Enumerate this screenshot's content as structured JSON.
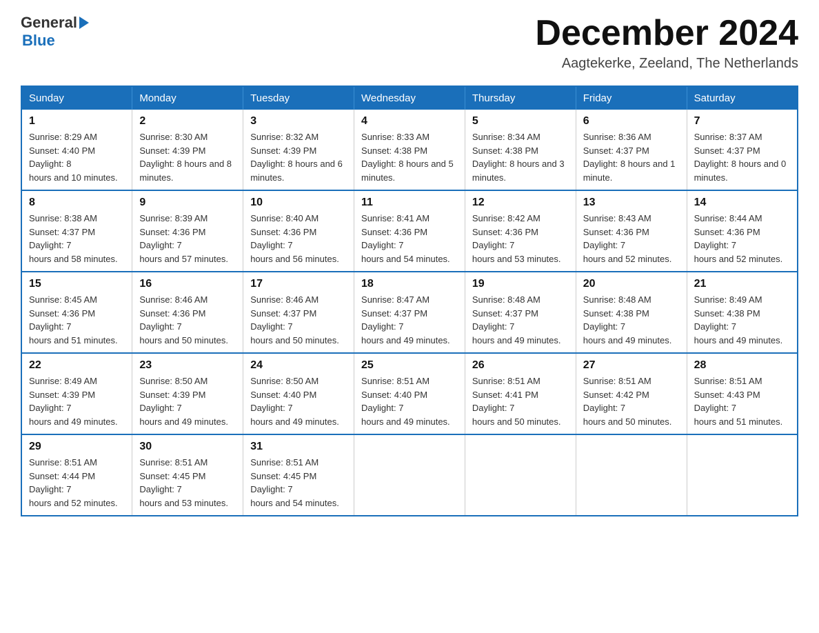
{
  "header": {
    "logo": {
      "general": "General",
      "blue": "Blue"
    },
    "title": "December 2024",
    "location": "Aagtekerke, Zeeland, The Netherlands"
  },
  "days_of_week": [
    "Sunday",
    "Monday",
    "Tuesday",
    "Wednesday",
    "Thursday",
    "Friday",
    "Saturday"
  ],
  "weeks": [
    [
      {
        "day": "1",
        "sunrise": "8:29 AM",
        "sunset": "4:40 PM",
        "daylight": "8 hours and 10 minutes."
      },
      {
        "day": "2",
        "sunrise": "8:30 AM",
        "sunset": "4:39 PM",
        "daylight": "8 hours and 8 minutes."
      },
      {
        "day": "3",
        "sunrise": "8:32 AM",
        "sunset": "4:39 PM",
        "daylight": "8 hours and 6 minutes."
      },
      {
        "day": "4",
        "sunrise": "8:33 AM",
        "sunset": "4:38 PM",
        "daylight": "8 hours and 5 minutes."
      },
      {
        "day": "5",
        "sunrise": "8:34 AM",
        "sunset": "4:38 PM",
        "daylight": "8 hours and 3 minutes."
      },
      {
        "day": "6",
        "sunrise": "8:36 AM",
        "sunset": "4:37 PM",
        "daylight": "8 hours and 1 minute."
      },
      {
        "day": "7",
        "sunrise": "8:37 AM",
        "sunset": "4:37 PM",
        "daylight": "8 hours and 0 minutes."
      }
    ],
    [
      {
        "day": "8",
        "sunrise": "8:38 AM",
        "sunset": "4:37 PM",
        "daylight": "7 hours and 58 minutes."
      },
      {
        "day": "9",
        "sunrise": "8:39 AM",
        "sunset": "4:36 PM",
        "daylight": "7 hours and 57 minutes."
      },
      {
        "day": "10",
        "sunrise": "8:40 AM",
        "sunset": "4:36 PM",
        "daylight": "7 hours and 56 minutes."
      },
      {
        "day": "11",
        "sunrise": "8:41 AM",
        "sunset": "4:36 PM",
        "daylight": "7 hours and 54 minutes."
      },
      {
        "day": "12",
        "sunrise": "8:42 AM",
        "sunset": "4:36 PM",
        "daylight": "7 hours and 53 minutes."
      },
      {
        "day": "13",
        "sunrise": "8:43 AM",
        "sunset": "4:36 PM",
        "daylight": "7 hours and 52 minutes."
      },
      {
        "day": "14",
        "sunrise": "8:44 AM",
        "sunset": "4:36 PM",
        "daylight": "7 hours and 52 minutes."
      }
    ],
    [
      {
        "day": "15",
        "sunrise": "8:45 AM",
        "sunset": "4:36 PM",
        "daylight": "7 hours and 51 minutes."
      },
      {
        "day": "16",
        "sunrise": "8:46 AM",
        "sunset": "4:36 PM",
        "daylight": "7 hours and 50 minutes."
      },
      {
        "day": "17",
        "sunrise": "8:46 AM",
        "sunset": "4:37 PM",
        "daylight": "7 hours and 50 minutes."
      },
      {
        "day": "18",
        "sunrise": "8:47 AM",
        "sunset": "4:37 PM",
        "daylight": "7 hours and 49 minutes."
      },
      {
        "day": "19",
        "sunrise": "8:48 AM",
        "sunset": "4:37 PM",
        "daylight": "7 hours and 49 minutes."
      },
      {
        "day": "20",
        "sunrise": "8:48 AM",
        "sunset": "4:38 PM",
        "daylight": "7 hours and 49 minutes."
      },
      {
        "day": "21",
        "sunrise": "8:49 AM",
        "sunset": "4:38 PM",
        "daylight": "7 hours and 49 minutes."
      }
    ],
    [
      {
        "day": "22",
        "sunrise": "8:49 AM",
        "sunset": "4:39 PM",
        "daylight": "7 hours and 49 minutes."
      },
      {
        "day": "23",
        "sunrise": "8:50 AM",
        "sunset": "4:39 PM",
        "daylight": "7 hours and 49 minutes."
      },
      {
        "day": "24",
        "sunrise": "8:50 AM",
        "sunset": "4:40 PM",
        "daylight": "7 hours and 49 minutes."
      },
      {
        "day": "25",
        "sunrise": "8:51 AM",
        "sunset": "4:40 PM",
        "daylight": "7 hours and 49 minutes."
      },
      {
        "day": "26",
        "sunrise": "8:51 AM",
        "sunset": "4:41 PM",
        "daylight": "7 hours and 50 minutes."
      },
      {
        "day": "27",
        "sunrise": "8:51 AM",
        "sunset": "4:42 PM",
        "daylight": "7 hours and 50 minutes."
      },
      {
        "day": "28",
        "sunrise": "8:51 AM",
        "sunset": "4:43 PM",
        "daylight": "7 hours and 51 minutes."
      }
    ],
    [
      {
        "day": "29",
        "sunrise": "8:51 AM",
        "sunset": "4:44 PM",
        "daylight": "7 hours and 52 minutes."
      },
      {
        "day": "30",
        "sunrise": "8:51 AM",
        "sunset": "4:45 PM",
        "daylight": "7 hours and 53 minutes."
      },
      {
        "day": "31",
        "sunrise": "8:51 AM",
        "sunset": "4:45 PM",
        "daylight": "7 hours and 54 minutes."
      },
      null,
      null,
      null,
      null
    ]
  ],
  "labels": {
    "sunrise": "Sunrise:",
    "sunset": "Sunset:",
    "daylight": "Daylight:"
  }
}
